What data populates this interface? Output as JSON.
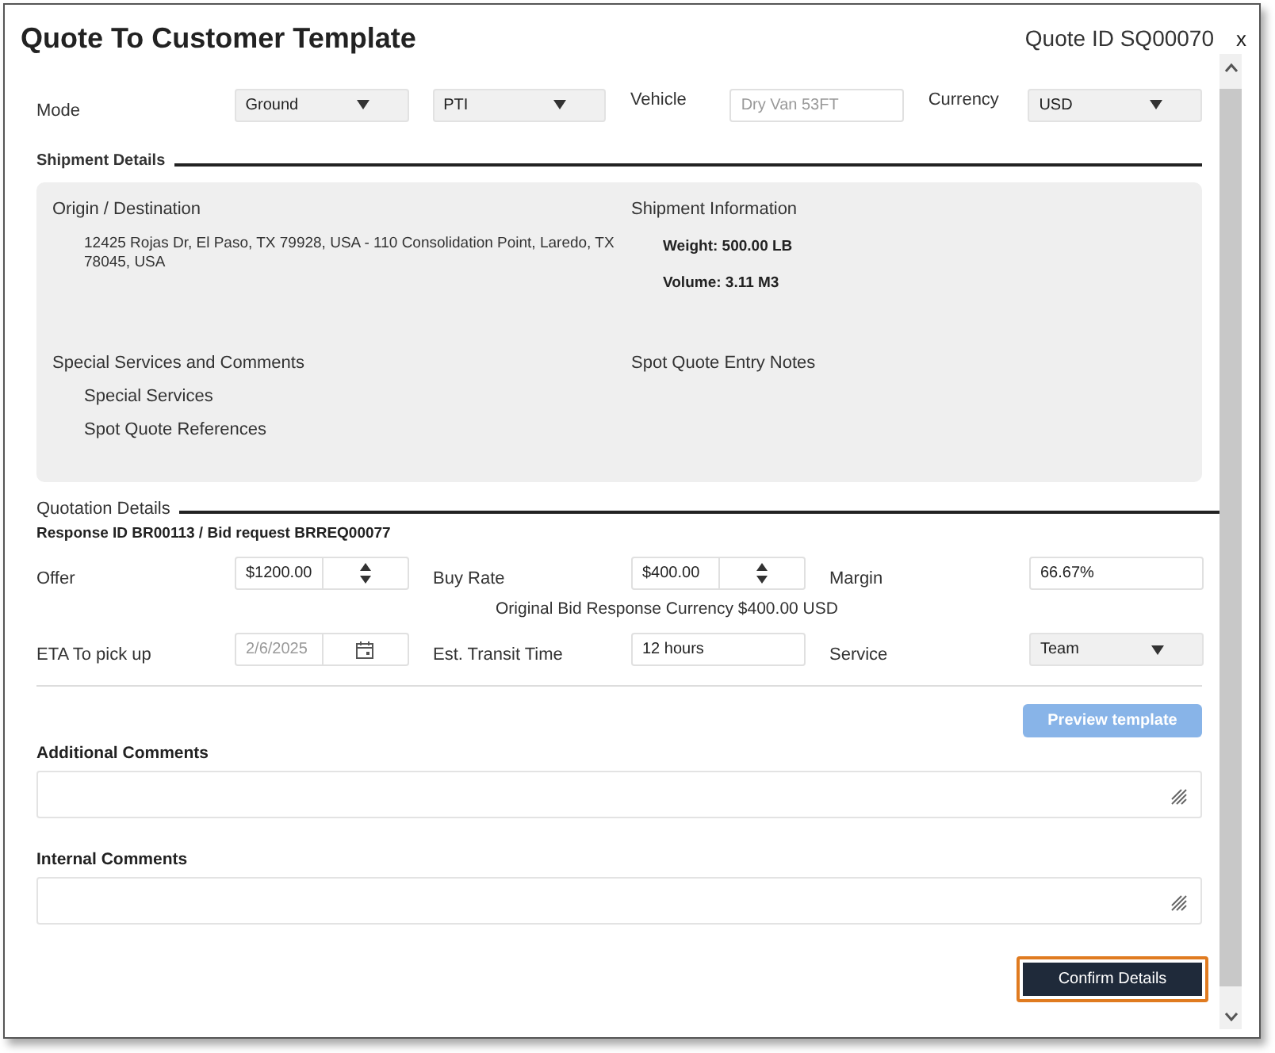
{
  "window": {
    "title": "Quote To Customer Template",
    "quote_id": "Quote ID SQ00070",
    "close": "x"
  },
  "top_row": {
    "mode_label": "Mode",
    "mode_selects": [
      {
        "value": "Ground"
      },
      {
        "value": "PTI"
      }
    ],
    "vehicle": {
      "label": "Vehicle",
      "placeholder": "Dry Van 53FT"
    },
    "currency": {
      "label": "Currency",
      "value": "USD"
    }
  },
  "shipment_details": {
    "heading": "Shipment Details",
    "origin_destination": {
      "heading": "Origin / Destination",
      "address": "12425 Rojas Dr, El Paso, TX 79928, USA - 110 Consolidation Point, Laredo, TX 78045, USA"
    },
    "shipment_information": {
      "heading": "Shipment Information",
      "lines": [
        "Weight: 500.00 LB",
        "Volume: 3.11 M3"
      ]
    },
    "special_services": {
      "heading": "Special Services and Comments",
      "items": [
        "Special Services",
        "Spot Quote References"
      ]
    },
    "spot_quote_entry_notes": {
      "heading": "Spot Quote Entry Notes"
    }
  },
  "quotation_details": {
    "heading": "Quotation Details",
    "response_line": "Response ID BR00113 / Bid request BRREQ00077",
    "fields": [
      {
        "label": "Offer",
        "kind": "number",
        "value": "$1200.00",
        "disabled": false
      },
      {
        "label": "Buy Rate",
        "kind": "number",
        "value": "$400.00",
        "disabled": false
      },
      {
        "label": "Margin",
        "kind": "text",
        "value": "66.67%",
        "disabled": false
      }
    ],
    "note": "Original Bid Response Currency $400.00 USD",
    "fields_2": [
      {
        "label": "ETA To pick up",
        "kind": "date",
        "value": "2/6/2025",
        "disabled": true
      },
      {
        "label": "Est. Transit Time",
        "kind": "text",
        "value": "12 hours",
        "disabled": false
      },
      {
        "label": "Service",
        "kind": "select",
        "value": "Team",
        "disabled": false
      }
    ]
  },
  "preview_button": {
    "label": "Preview template",
    "disabled": true
  },
  "comments": [
    {
      "label": "Additional Comments"
    },
    {
      "label": "Internal Comments"
    }
  ],
  "confirm_button": {
    "label": "Confirm Details",
    "focused": true
  }
}
